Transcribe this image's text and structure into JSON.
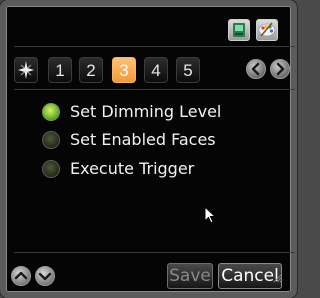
{
  "header": {
    "icons": [
      "screen-icon",
      "palette-icon"
    ]
  },
  "tabs": {
    "star_icon": "star-icon",
    "items": [
      "1",
      "2",
      "3",
      "4",
      "5"
    ],
    "active_index": 2
  },
  "options": [
    {
      "label": "Set Dimming Level",
      "selected": true
    },
    {
      "label": "Set Enabled Faces",
      "selected": false
    },
    {
      "label": "Execute Trigger",
      "selected": false
    }
  ],
  "footer": {
    "save_label": "Save",
    "cancel_label": "Cancel"
  },
  "colors": {
    "accent_tab": "#f39a38",
    "radio_on": "#69b32a",
    "background": "#050505"
  }
}
